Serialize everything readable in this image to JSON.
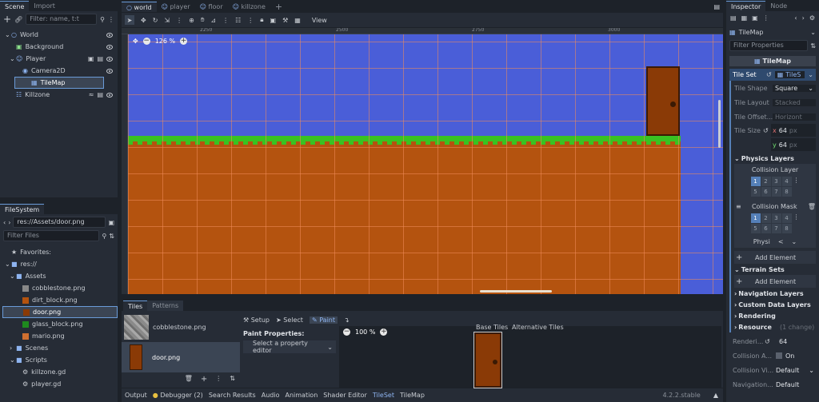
{
  "scene": {
    "tab_scene": "Scene",
    "tab_import": "Import",
    "filter_placeholder": "Filter: name, t:t",
    "nodes": [
      {
        "label": "World"
      },
      {
        "label": "Background"
      },
      {
        "label": "Player"
      },
      {
        "label": "Camera2D"
      },
      {
        "label": "TileMap"
      },
      {
        "label": "Killzone"
      }
    ]
  },
  "filesystem": {
    "tab": "FileSystem",
    "path": "res://Assets/door.png",
    "filter_placeholder": "Filter Files",
    "items": [
      {
        "label": "Favorites:"
      },
      {
        "label": "res://"
      },
      {
        "label": "Assets"
      },
      {
        "label": "cobblestone.png"
      },
      {
        "label": "dirt_block.png"
      },
      {
        "label": "door.png"
      },
      {
        "label": "glass_block.png"
      },
      {
        "label": "mario.png"
      },
      {
        "label": "Scenes"
      },
      {
        "label": "Scripts"
      },
      {
        "label": "killzone.gd"
      },
      {
        "label": "player.gd"
      }
    ]
  },
  "editor_tabs": [
    {
      "label": "world"
    },
    {
      "label": "player"
    },
    {
      "label": "floor"
    },
    {
      "label": "killzone"
    }
  ],
  "toolbar": {
    "view_label": "View"
  },
  "viewport": {
    "zoom": "126 %",
    "ruler": [
      "2250",
      "2500",
      "2750",
      "3000"
    ]
  },
  "tiles_panel": {
    "tab_tiles": "Tiles",
    "tab_patterns": "Patterns",
    "tiles": [
      {
        "label": "cobblestone.png"
      },
      {
        "label": "door.png"
      }
    ],
    "setup": "Setup",
    "select": "Select",
    "paint": "Paint",
    "paint_props": "Paint Properties:",
    "prop_editor_placeholder": "Select a property editor",
    "zoom": "100 %",
    "base_tiles": "Base Tiles",
    "alt_tiles": "Alternative Tiles"
  },
  "bottom_bar": {
    "tabs": [
      "Output",
      "Debugger (2)",
      "Search Results",
      "Audio",
      "Animation",
      "Shader Editor",
      "TileSet",
      "TileMap"
    ],
    "version": "4.2.2.stable"
  },
  "inspector": {
    "tab_inspector": "Inspector",
    "tab_node": "Node",
    "node": "TileMap",
    "filter_placeholder": "Filter Properties",
    "section": "TileMap",
    "tileset_label": "Tile Set",
    "tileset_value": "TileS",
    "props": [
      {
        "k": "Tile Shape",
        "v": "Square"
      },
      {
        "k": "Tile Layout",
        "v": "Stacked"
      },
      {
        "k": "Tile Offset...",
        "v": "Horizont"
      }
    ],
    "tile_size_label": "Tile Size",
    "size_x": "64",
    "size_y": "64",
    "unit": "px",
    "physics_layers": "Physics Layers",
    "collision_layer": "Collision Layer",
    "collision_mask": "Collision Mask",
    "physi": "Physi",
    "add_element": "Add Element",
    "terrain_sets": "Terrain Sets",
    "sections": [
      "Navigation Layers",
      "Custom Data Layers",
      "Rendering"
    ],
    "resource": "Resource",
    "changes": "(1 change)",
    "rendering_label": "Renderi...",
    "rendering_value": "64",
    "collision_a_label": "Collision A...",
    "collision_a_value": "On",
    "collision_vi_label": "Collision Vi...",
    "collision_vi_value": "Default",
    "navigation_label": "Navigation...",
    "navigation_value": "Default"
  },
  "colors": {
    "sky": "#4a5ed8",
    "grass": "#39c222",
    "dirt": "#b4530f",
    "door": "#8a3a06",
    "accent": "#6a9bd8"
  }
}
